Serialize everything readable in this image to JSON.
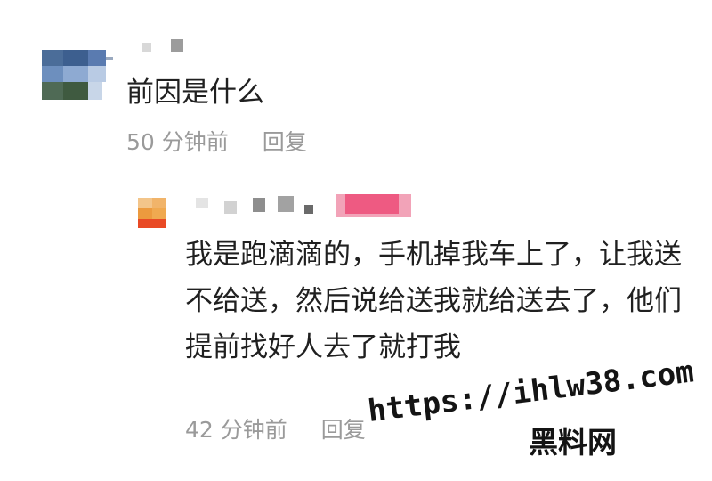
{
  "comments": [
    {
      "text": "前因是什么",
      "time": "50 分钟前",
      "reply_label": "回复"
    },
    {
      "text": "我是跑滴滴的，手机掉我车上了，让我送不给送，然后说给送我就给送去了，他们提前找好人去了就打我",
      "time": "42 分钟前",
      "reply_label": "回复"
    }
  ],
  "watermark": {
    "url": "https://ihlw38.com",
    "site": "黑料网"
  }
}
